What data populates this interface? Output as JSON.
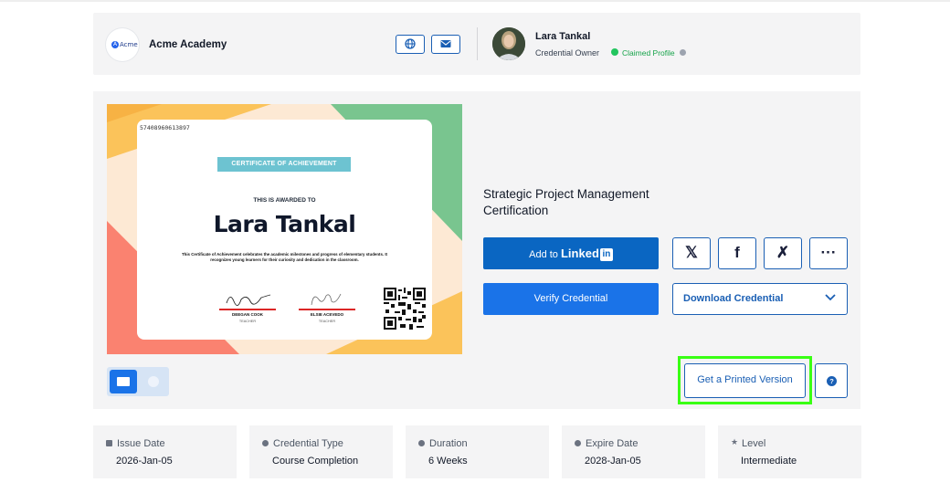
{
  "header": {
    "org_logo_text": "Acme",
    "org_name": "Acme Academy",
    "owner_name": "Lara Tankal",
    "owner_role": "Credential Owner",
    "claimed_label": "Claimed Profile"
  },
  "certificate": {
    "serial": "57408960613897",
    "banner": "CERTIFICATE OF ACHIEVEMENT",
    "awarded_to": "THIS IS AWARDED TO",
    "recipient": "Lara Tankal",
    "description": "This Certificate of Achievement celebrates the academic milestones and progress of elementary students. It recognizes young learners for their curiosity and dedication in the classroom.",
    "signers": [
      {
        "name": "DEEGAN COOK",
        "role": "TEACHER"
      },
      {
        "name": "ELSIE ACEVEDO",
        "role": "TEACHER"
      }
    ]
  },
  "credential": {
    "title": "Strategic Project Management Certification",
    "linkedin_prefix": "Add to",
    "linkedin_brand": "Linked",
    "linkedin_in": "in",
    "verify_label": "Verify Credential",
    "download_label": "Download Credential",
    "share_icons": [
      "x-icon",
      "facebook-icon",
      "xing-icon",
      "more-icon"
    ],
    "share_glyphs": [
      "𝕏",
      "f",
      "✗",
      "···"
    ],
    "print_label": "Get a Printed Version",
    "help_glyph": "?"
  },
  "details": [
    {
      "label": "Issue Date",
      "value": "2026-Jan-05"
    },
    {
      "label": "Credential Type",
      "value": "Course Completion"
    },
    {
      "label": "Duration",
      "value": "6 Weeks"
    },
    {
      "label": "Expire Date",
      "value": "2028-Jan-05"
    },
    {
      "label": "Level",
      "value": "Intermediate"
    }
  ],
  "colors": {
    "primary": "#1a73e8",
    "linkedin": "#0a66c2",
    "highlight": "#39ff14",
    "claimed": "#16a34a"
  }
}
